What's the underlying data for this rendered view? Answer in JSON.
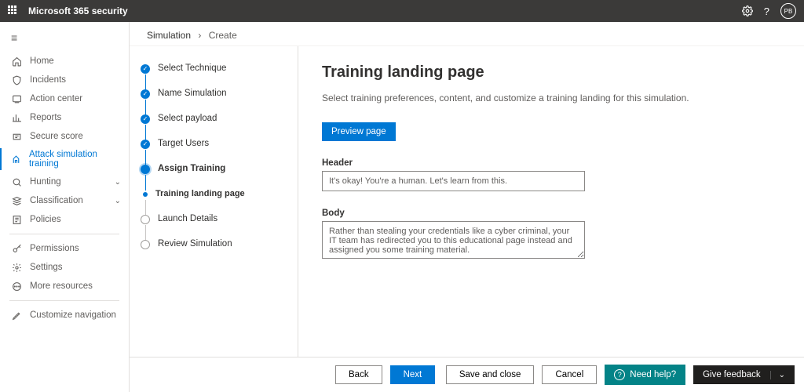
{
  "topbar": {
    "title": "Microsoft 365 security",
    "avatar": "PB"
  },
  "nav": {
    "items": [
      {
        "label": "Home",
        "iconKey": "home"
      },
      {
        "label": "Incidents",
        "iconKey": "shield"
      },
      {
        "label": "Action center",
        "iconKey": "action"
      },
      {
        "label": "Reports",
        "iconKey": "report"
      },
      {
        "label": "Secure score",
        "iconKey": "score"
      },
      {
        "label": "Attack simulation training",
        "iconKey": "attack",
        "selected": true
      },
      {
        "label": "Hunting",
        "iconKey": "hunt",
        "chevron": true
      },
      {
        "label": "Classification",
        "iconKey": "class",
        "chevron": true
      },
      {
        "label": "Policies",
        "iconKey": "policy"
      }
    ],
    "section2": [
      {
        "label": "Permissions",
        "iconKey": "perm"
      },
      {
        "label": "Settings",
        "iconKey": "gear"
      },
      {
        "label": "More resources",
        "iconKey": "more"
      }
    ],
    "section3": [
      {
        "label": "Customize navigation",
        "iconKey": "pen"
      }
    ]
  },
  "breadcrumb": {
    "first": "Simulation",
    "second": "Create"
  },
  "wizard": {
    "steps": [
      {
        "label": "Select Technique",
        "state": "done"
      },
      {
        "label": "Name Simulation",
        "state": "done"
      },
      {
        "label": "Select payload",
        "state": "done"
      },
      {
        "label": "Target Users",
        "state": "done"
      },
      {
        "label": "Assign Training",
        "state": "current"
      },
      {
        "label": "Training landing page",
        "state": "sub"
      },
      {
        "label": "Launch Details",
        "state": "future"
      },
      {
        "label": "Review Simulation",
        "state": "future",
        "last": true
      }
    ]
  },
  "panel": {
    "heading": "Training landing page",
    "description": "Select training preferences, content, and customize a training landing for this simulation.",
    "previewButton": "Preview page",
    "headerLabel": "Header",
    "headerValue": "It's okay! You're a human. Let's learn from this.",
    "bodyLabel": "Body",
    "bodyValue": "Rather than stealing your credentials like a cyber criminal, your IT team has redirected you to this educational page instead and assigned you some training material."
  },
  "footer": {
    "back": "Back",
    "next": "Next",
    "save": "Save and close",
    "cancel": "Cancel",
    "help": "Need help?",
    "feedback": "Give feedback"
  }
}
